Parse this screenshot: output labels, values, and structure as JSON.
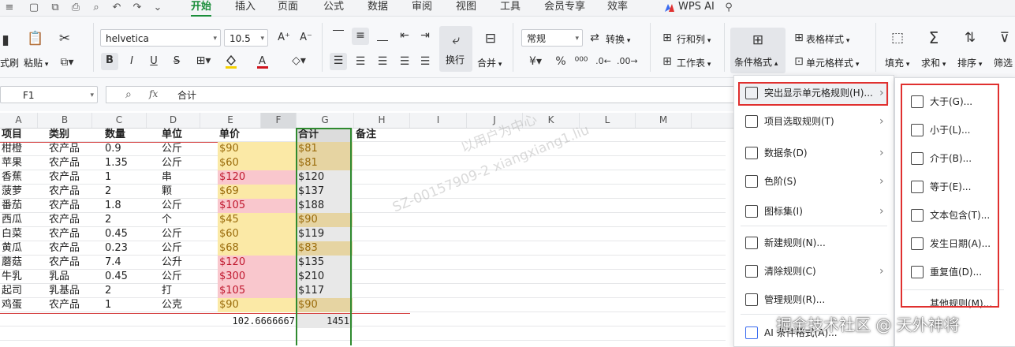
{
  "menubar": {
    "tabs": [
      "开始",
      "插入",
      "页面",
      "公式",
      "数据",
      "审阅",
      "视图",
      "工具",
      "会员专享",
      "效率"
    ],
    "active_tab": "开始",
    "wps_ai": "WPS AI"
  },
  "ribbon": {
    "brush_label": "式刷",
    "paste_label": "粘贴",
    "font_name": "helvetica",
    "font_size": "10.5",
    "bold": "B",
    "italic": "I",
    "underline": "U",
    "wrap_label": "换行",
    "merge_label": "合并",
    "number_format": "常规",
    "convert_label": "转换",
    "rowcol_label": "行和列",
    "worksheet_label": "工作表",
    "cond_format_label": "条件格式",
    "table_style_label": "表格样式",
    "cell_style_label": "单元格样式",
    "fill_label": "填充",
    "sum_label": "求和",
    "sort_label": "排序",
    "filter_label": "筛选"
  },
  "formula_bar": {
    "name_box": "F1",
    "fx": "fx",
    "content": "合计"
  },
  "columns": [
    "A",
    "B",
    "C",
    "D",
    "E",
    "F",
    "G",
    "H",
    "I",
    "J",
    "K",
    "L",
    "M"
  ],
  "table": {
    "headers": [
      "项目",
      "类别",
      "数量",
      "单位",
      "单价",
      "合计",
      "备注"
    ],
    "rows": [
      [
        "柑橙",
        "农产品",
        "0.9",
        "公斤",
        "$90",
        "$81"
      ],
      [
        "苹果",
        "农产品",
        "1.35",
        "公斤",
        "$60",
        "$81"
      ],
      [
        "香蕉",
        "农产品",
        "1",
        "串",
        "$120",
        "$120"
      ],
      [
        "菠萝",
        "农产品",
        "2",
        "颗",
        "$69",
        "$137"
      ],
      [
        "番茄",
        "农产品",
        "1.8",
        "公斤",
        "$105",
        "$188"
      ],
      [
        "西瓜",
        "农产品",
        "2",
        "个",
        "$45",
        "$90"
      ],
      [
        "白菜",
        "农产品",
        "0.45",
        "公斤",
        "$60",
        "$119"
      ],
      [
        "黄瓜",
        "农产品",
        "0.23",
        "公斤",
        "$68",
        "$83"
      ],
      [
        "蘑菇",
        "农产品",
        "7.4",
        "公升",
        "$120",
        "$135"
      ],
      [
        "牛乳",
        "乳品",
        "0.45",
        "公斤",
        "$300",
        "$210"
      ],
      [
        "起司",
        "乳基品",
        "2",
        "打",
        "$105",
        "$117"
      ],
      [
        "鸡蛋",
        "农产品",
        "1",
        "公克",
        "$90",
        "$90"
      ]
    ],
    "e_highlight": [
      "y",
      "y",
      "p",
      "y",
      "p",
      "y",
      "y",
      "y",
      "p",
      "p",
      "p",
      "y"
    ],
    "f_highlight": [
      "t",
      "t",
      "n",
      "n",
      "n",
      "t",
      "n",
      "t",
      "n",
      "n",
      "n",
      "t"
    ],
    "avg_value": "102.6666667",
    "total_value": "1451"
  },
  "watermark": {
    "line1": "以用户为中心",
    "line2": "SZ-00157909-2 xiangxiang1.liu"
  },
  "menu_main": {
    "items": [
      {
        "label": "突出显示单元格规则(H)...",
        "has_sub": true
      },
      {
        "label": "项目选取规则(T)",
        "has_sub": true
      },
      {
        "label": "数据条(D)",
        "has_sub": true
      },
      {
        "label": "色阶(S)",
        "has_sub": true
      },
      {
        "label": "图标集(I)",
        "has_sub": true
      },
      {
        "label": "新建规则(N)...",
        "has_sub": false
      },
      {
        "label": "清除规则(C)",
        "has_sub": true
      },
      {
        "label": "管理规则(R)...",
        "has_sub": false
      },
      {
        "label": "AI 条件格式(A)...",
        "has_sub": false
      }
    ]
  },
  "menu_sub": {
    "items": [
      "大于(G)...",
      "小于(L)...",
      "介于(B)...",
      "等于(E)...",
      "文本包含(T)...",
      "发生日期(A)...",
      "重复值(D)..."
    ],
    "more": "其他规则(M)..."
  },
  "credit": "掘金技术社区 @ 天外神将"
}
